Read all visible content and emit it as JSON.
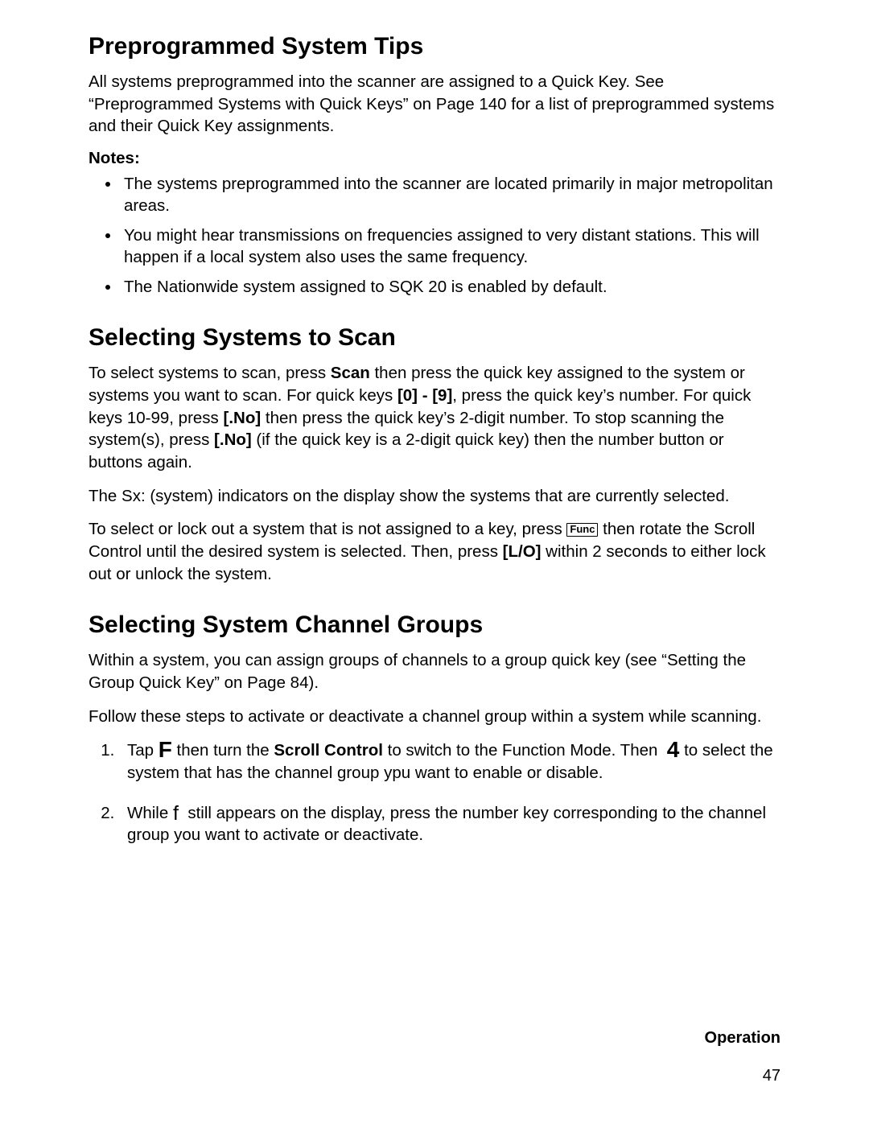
{
  "section1": {
    "heading": "Preprogrammed System Tips",
    "intro": "All systems preprogrammed into the scanner are assigned to a Quick Key. See “Preprogrammed Systems with Quick Keys” on Page 140 for a list of preprogrammed systems and their Quick Key assignments.",
    "notes_label": "Notes:",
    "notes": [
      "The systems preprogrammed into the scanner are located primarily in major metropolitan areas.",
      "You might hear transmissions on frequencies assigned to very distant stations. This will happen if a local system also uses the same frequency.",
      "The Nationwide system assigned to SQK 20 is enabled by default."
    ]
  },
  "section2": {
    "heading": "Selecting Systems to Scan",
    "p1_a": "To select systems to scan, press ",
    "p1_scan": "Scan",
    "p1_b": " then press the quick key assigned to the system or systems you want to scan. For quick keys ",
    "p1_range": "[0] - [9]",
    "p1_c": ", press the quick key’s number. For quick keys 10-99, press ",
    "p1_no1": "[.No]",
    "p1_d": " then press the quick key’s 2-digit number. To stop scanning the system(s), press ",
    "p1_no2": "[.No]",
    "p1_e": " (if the quick key is a 2-digit quick key) then the number button or buttons again.",
    "p2": "The Sx: (system) indicators on the display show the systems that are currently selected.",
    "p3_a": "To select or lock out a system that is not assigned to a key, press ",
    "p3_func": "Func",
    "p3_b": " then rotate the Scroll Control until the desired system is selected. Then, press ",
    "p3_lo": "[L/O]",
    "p3_c": " within 2 seconds to either lock out or unlock the system."
  },
  "section3": {
    "heading": "Selecting System Channel Groups",
    "p1": "Within a system, you can assign groups of channels to a group quick key (see “Setting the Group Quick Key” on Page 84).",
    "p2": "Follow these steps to activate or deactivate a channel group within a system while scanning.",
    "step1_a": "Tap ",
    "step1_F": "F",
    "step1_b": " then turn the ",
    "step1_sc": "Scroll Control",
    "step1_c": " to switch to the Function Mode. Then ",
    "step1_4": "4",
    "step1_d": " to select the system that has the channel group ypu want to enable or disable.",
    "step2_a": "While ",
    "step2_f": "f",
    "step2_b": " still appears on the display, press the number key corresponding to the channel group you want to activate or deactivate."
  },
  "footer": {
    "label": "Operation",
    "page": "47"
  }
}
